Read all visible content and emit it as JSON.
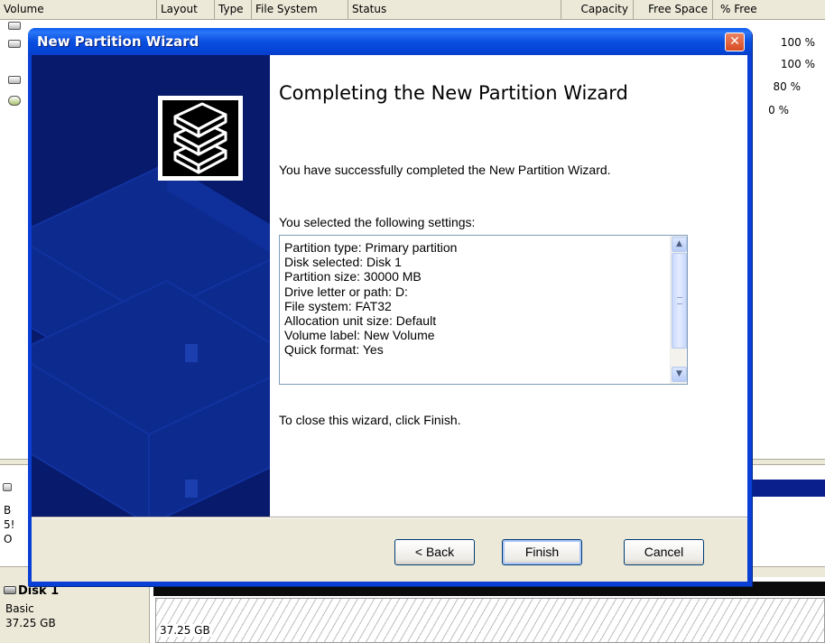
{
  "background": {
    "columns": [
      "Volume",
      "Layout",
      "Type",
      "File System",
      "Status",
      "Capacity",
      "Free Space",
      "% Free"
    ],
    "percent_free": [
      "100 %",
      "100 %",
      "80 %",
      "0 %"
    ],
    "disk0_partial": [
      "B",
      "5!",
      "O"
    ],
    "disk1": {
      "title": "Disk 1",
      "type": "Basic",
      "size": "37.25 GB",
      "unallocated_size": "37.25 GB"
    }
  },
  "wizard": {
    "title": "New Partition Wizard",
    "close_glyph": "✕",
    "heading": "Completing the New Partition Wizard",
    "success_text": "You have successfully completed the New Partition Wizard.",
    "settings_label": "You selected the following settings:",
    "settings": [
      "Partition type: Primary partition",
      "Disk selected: Disk 1",
      "Partition size: 30000 MB",
      "Drive letter or path: D:",
      "File system: FAT32",
      "Allocation unit size: Default",
      "Volume label: New Volume",
      "Quick format: Yes"
    ],
    "scroll_up_glyph": "▲",
    "scroll_down_glyph": "▼",
    "close_hint": "To close this wizard, click Finish.",
    "buttons": {
      "back": "< Back",
      "finish": "Finish",
      "cancel": "Cancel"
    }
  },
  "colors": {
    "titlebar": "#0a4fe0",
    "banner": "#071a6b",
    "dialog_face": "#ece9d8",
    "close_button": "#d84b20"
  },
  "icons": [
    "disk-icon",
    "cd-drive-icon",
    "stacked-disks-logo-icon",
    "close-icon",
    "scroll-up-icon",
    "scroll-down-icon"
  ]
}
